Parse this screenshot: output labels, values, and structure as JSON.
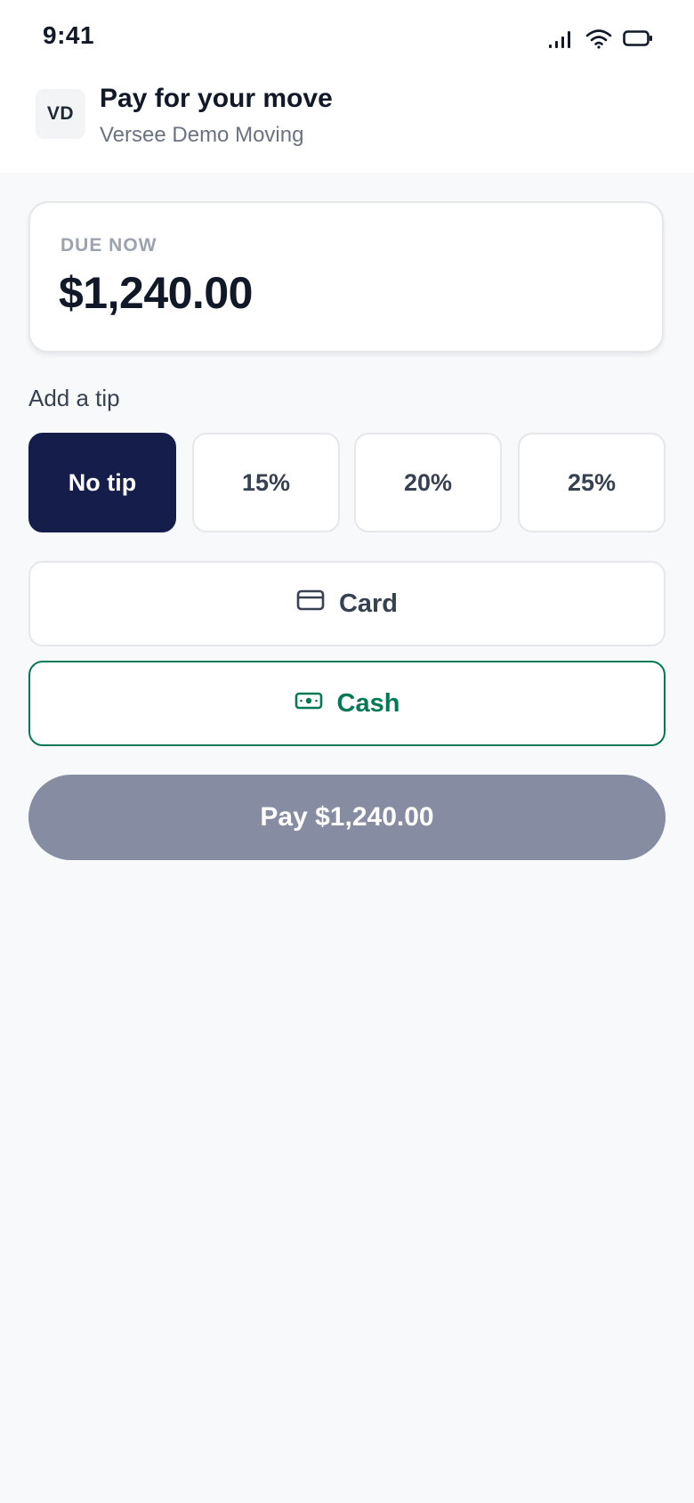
{
  "status_bar": {
    "time": "9:41",
    "icons": [
      "signal-icon",
      "wifi-icon",
      "battery-icon"
    ]
  },
  "header": {
    "avatar_initials": "VD",
    "title": "Pay for your move",
    "subtitle": "Versee Demo Moving"
  },
  "due": {
    "label": "DUE NOW",
    "amount": "$1,240.00"
  },
  "tip": {
    "heading": "Add a tip",
    "selected": "No tip",
    "options": [
      {
        "label": "No tip",
        "selected": true
      },
      {
        "label": "15%",
        "selected": false
      },
      {
        "label": "20%",
        "selected": false
      },
      {
        "label": "25%",
        "selected": false
      }
    ]
  },
  "payment_methods": [
    {
      "label": "Card",
      "icon": "credit-card-icon",
      "selected": false
    },
    {
      "label": "Cash",
      "icon": "cash-icon",
      "selected": true
    }
  ],
  "pay_button": {
    "label": "Pay $1,240.00"
  },
  "colors": {
    "accent_navy": "#151d4a",
    "cash_green": "#047857",
    "pay_disabled": "#868ca1",
    "background": "#f8f9fb"
  }
}
